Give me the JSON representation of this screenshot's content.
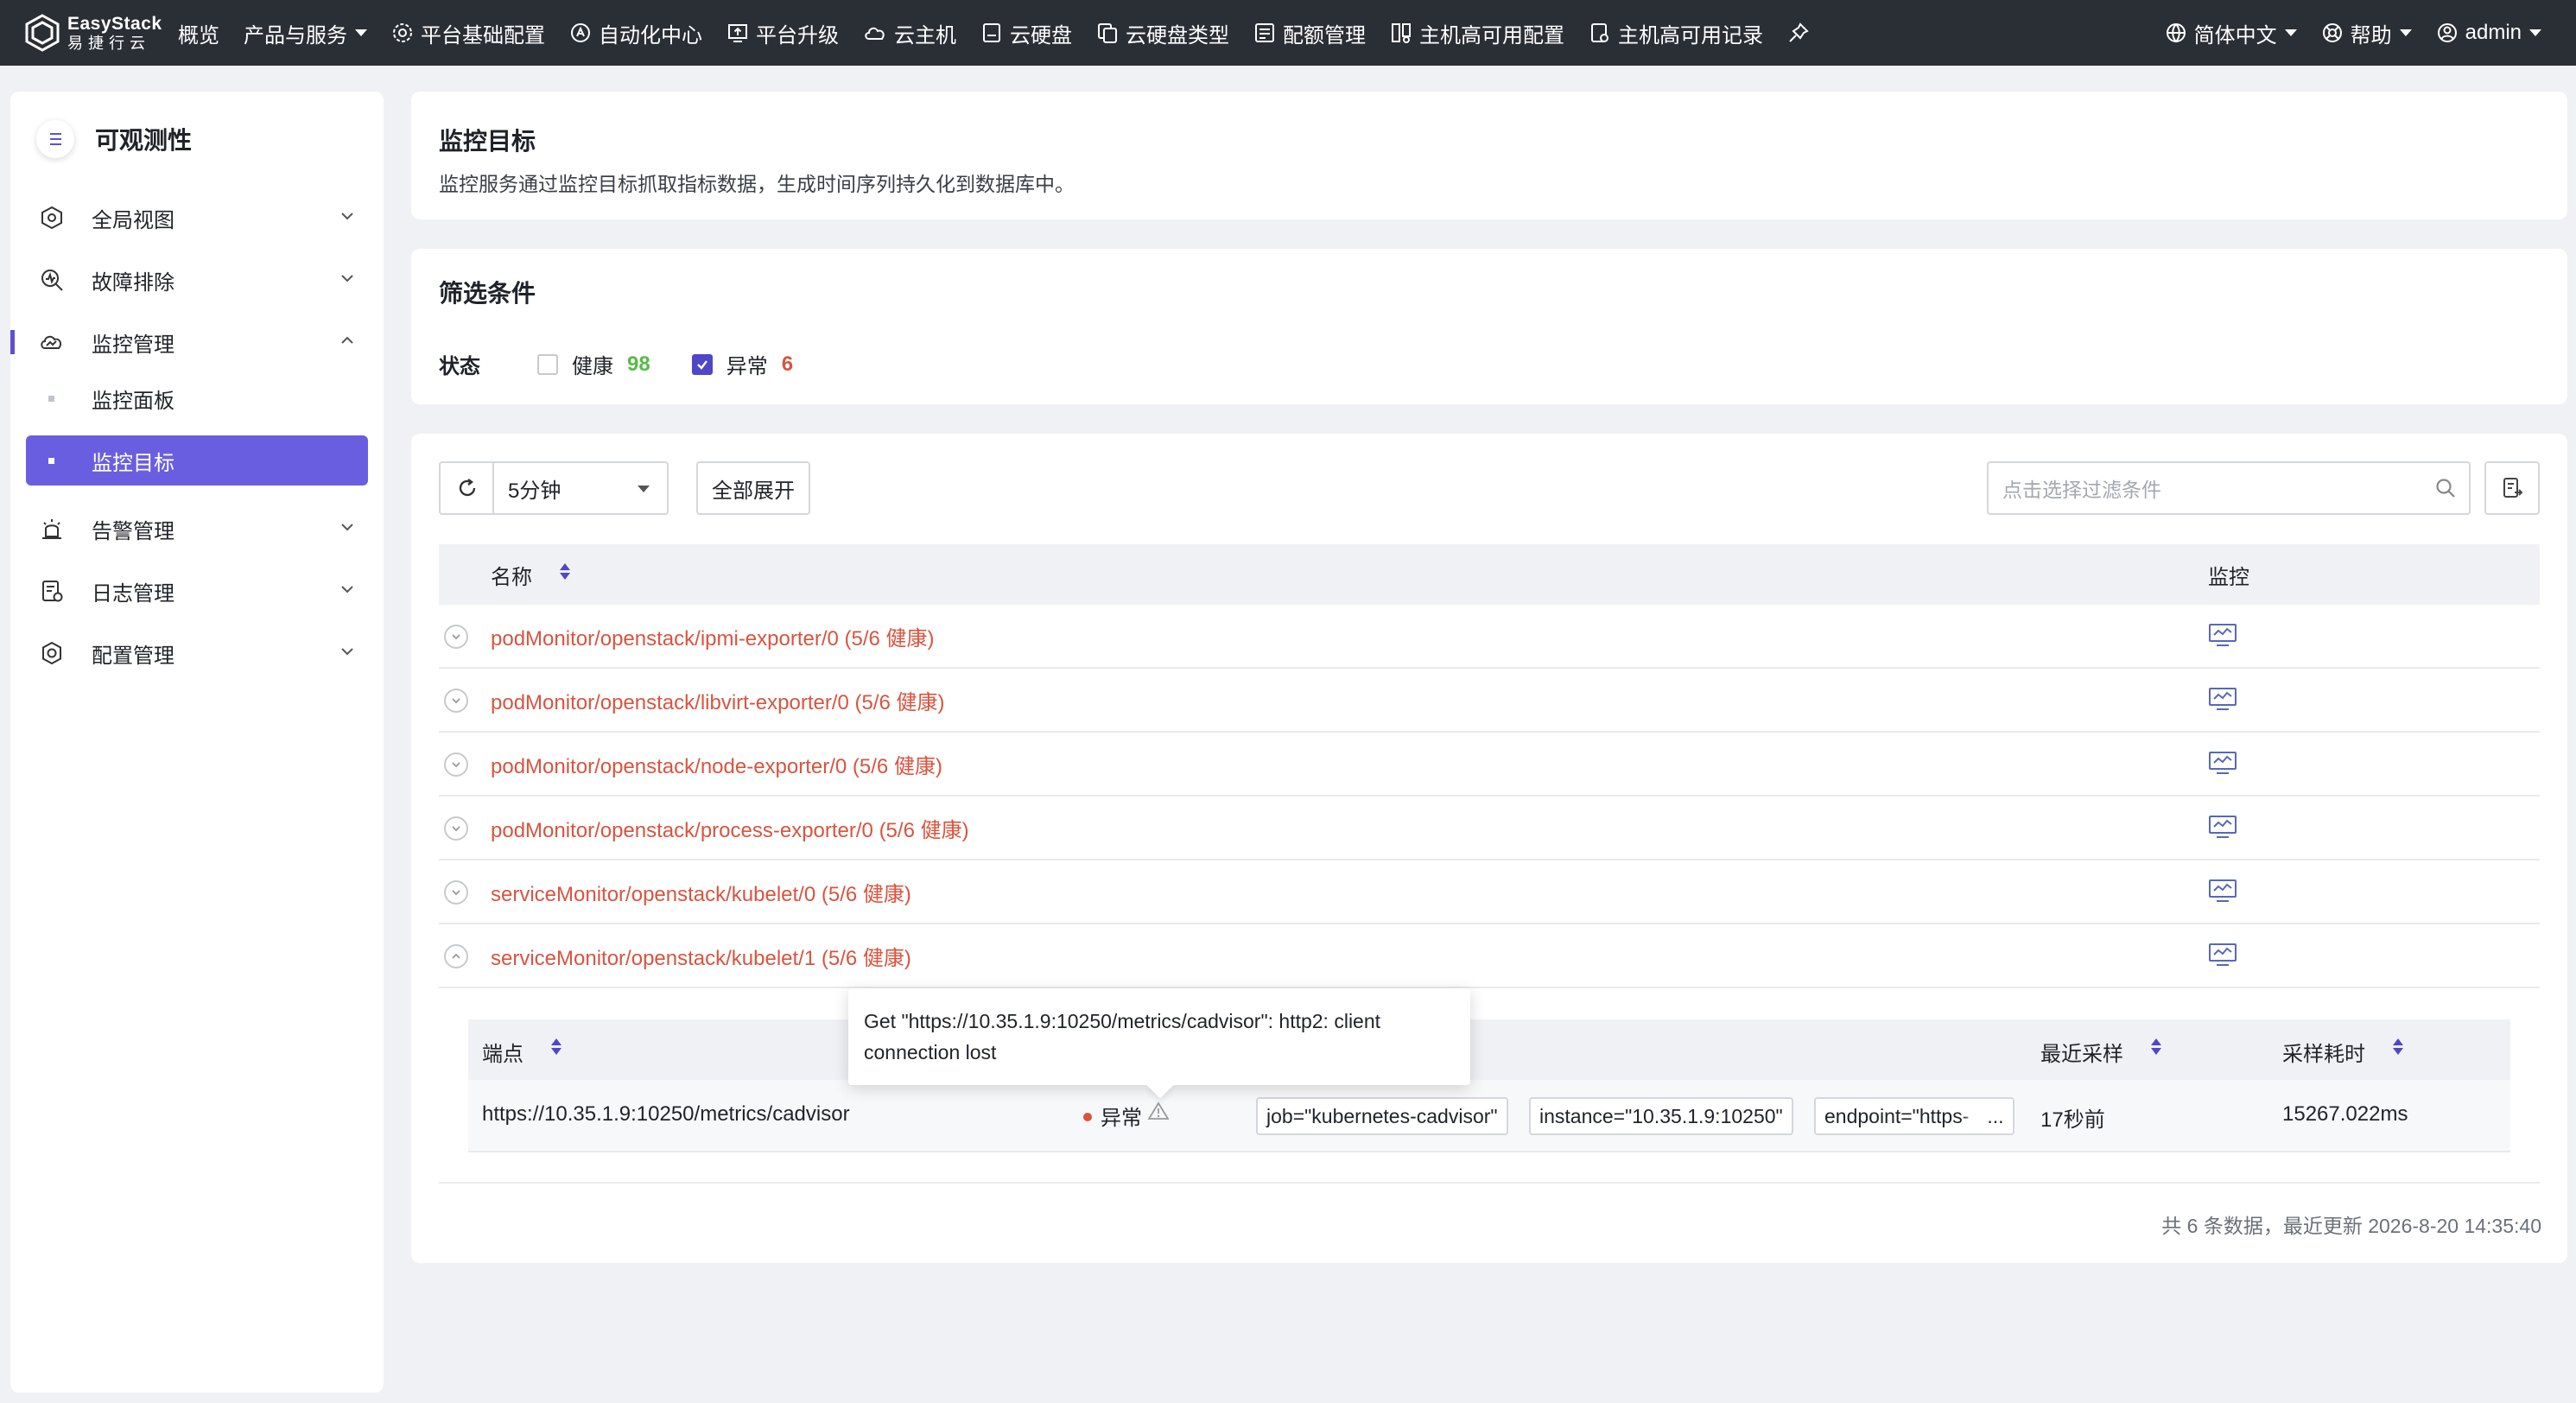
{
  "app": {
    "brand": "EasyStack",
    "brand_cn": "易捷行云"
  },
  "topnav": {
    "items": [
      {
        "label": "概览",
        "icon": "none"
      },
      {
        "label": "产品与服务",
        "icon": "none",
        "dropdown": true
      },
      {
        "label": "平台基础配置",
        "icon": "gear-icon"
      },
      {
        "label": "自动化中心",
        "icon": "automation-icon"
      },
      {
        "label": "平台升级",
        "icon": "upgrade-icon"
      },
      {
        "label": "云主机",
        "icon": "cloud-icon"
      },
      {
        "label": "云硬盘",
        "icon": "disk-icon"
      },
      {
        "label": "云硬盘类型",
        "icon": "disk-type-icon"
      },
      {
        "label": "配额管理",
        "icon": "quota-icon"
      },
      {
        "label": "主机高可用配置",
        "icon": "ha-config-icon"
      },
      {
        "label": "主机高可用记录",
        "icon": "ha-record-icon"
      }
    ],
    "language": "简体中文",
    "help": "帮助",
    "user": "admin"
  },
  "sidebar": {
    "title": "可观测性",
    "items": [
      {
        "label": "全局视图",
        "icon": "global-view-icon",
        "expanded": false
      },
      {
        "label": "故障排除",
        "icon": "troubleshoot-icon",
        "expanded": false
      },
      {
        "label": "监控管理",
        "icon": "monitor-manage-icon",
        "expanded": true
      },
      {
        "label": "告警管理",
        "icon": "alarm-icon",
        "expanded": false
      },
      {
        "label": "日志管理",
        "icon": "log-icon",
        "expanded": false
      },
      {
        "label": "配置管理",
        "icon": "config-icon",
        "expanded": false
      }
    ],
    "subitems": [
      {
        "label": "监控面板",
        "active": false
      },
      {
        "label": "监控目标",
        "active": true
      }
    ]
  },
  "header_card": {
    "title": "监控目标",
    "description": "监控服务通过监控目标抓取指标数据，生成时间序列持久化到数据库中。"
  },
  "filter_card": {
    "title": "筛选条件",
    "status_label": "状态",
    "healthy": {
      "label": "健康",
      "count": "98",
      "checked": false
    },
    "abnormal": {
      "label": "异常",
      "count": "6",
      "checked": true
    }
  },
  "toolbar": {
    "interval": "5分钟",
    "expand_all": "全部展开",
    "search_placeholder": "点击选择过滤条件"
  },
  "table": {
    "columns": {
      "name": "名称",
      "monitor": "监控"
    },
    "rows": [
      {
        "name": "podMonitor/openstack/ipmi-exporter/0 (5/6 健康)",
        "expanded": false
      },
      {
        "name": "podMonitor/openstack/libvirt-exporter/0 (5/6 健康)",
        "expanded": false
      },
      {
        "name": "podMonitor/openstack/node-exporter/0 (5/6 健康)",
        "expanded": false
      },
      {
        "name": "podMonitor/openstack/process-exporter/0 (5/6 健康)",
        "expanded": false
      },
      {
        "name": "serviceMonitor/openstack/kubelet/0 (5/6 健康)",
        "expanded": false
      },
      {
        "name": "serviceMonitor/openstack/kubelet/1 (5/6 健康)",
        "expanded": true
      }
    ]
  },
  "subtable": {
    "columns": {
      "endpoint": "端点",
      "last_scrape": "最近采样",
      "duration": "采样耗时"
    },
    "row": {
      "endpoint": "https://10.35.1.9:10250/metrics/cadvisor",
      "status": "异常",
      "labels": [
        "job=\"kubernetes-cadvisor\"",
        "instance=\"10.35.1.9:10250\"",
        "endpoint=\"https-"
      ],
      "more": "...",
      "last_scrape": "17秒前",
      "duration": "15267.022ms"
    }
  },
  "tooltip": {
    "line1": "Get \"https://10.35.1.9:10250/metrics/cadvisor\": http2: client",
    "line2": "connection lost"
  },
  "footer": {
    "summary": "共 6 条数据，最近更新  2026-8-20 14:35:40"
  },
  "colors": {
    "accent": "#6a5ee0",
    "topbar": "#2a2e35",
    "healthy": "#5ab94a",
    "error": "#d9543f"
  }
}
